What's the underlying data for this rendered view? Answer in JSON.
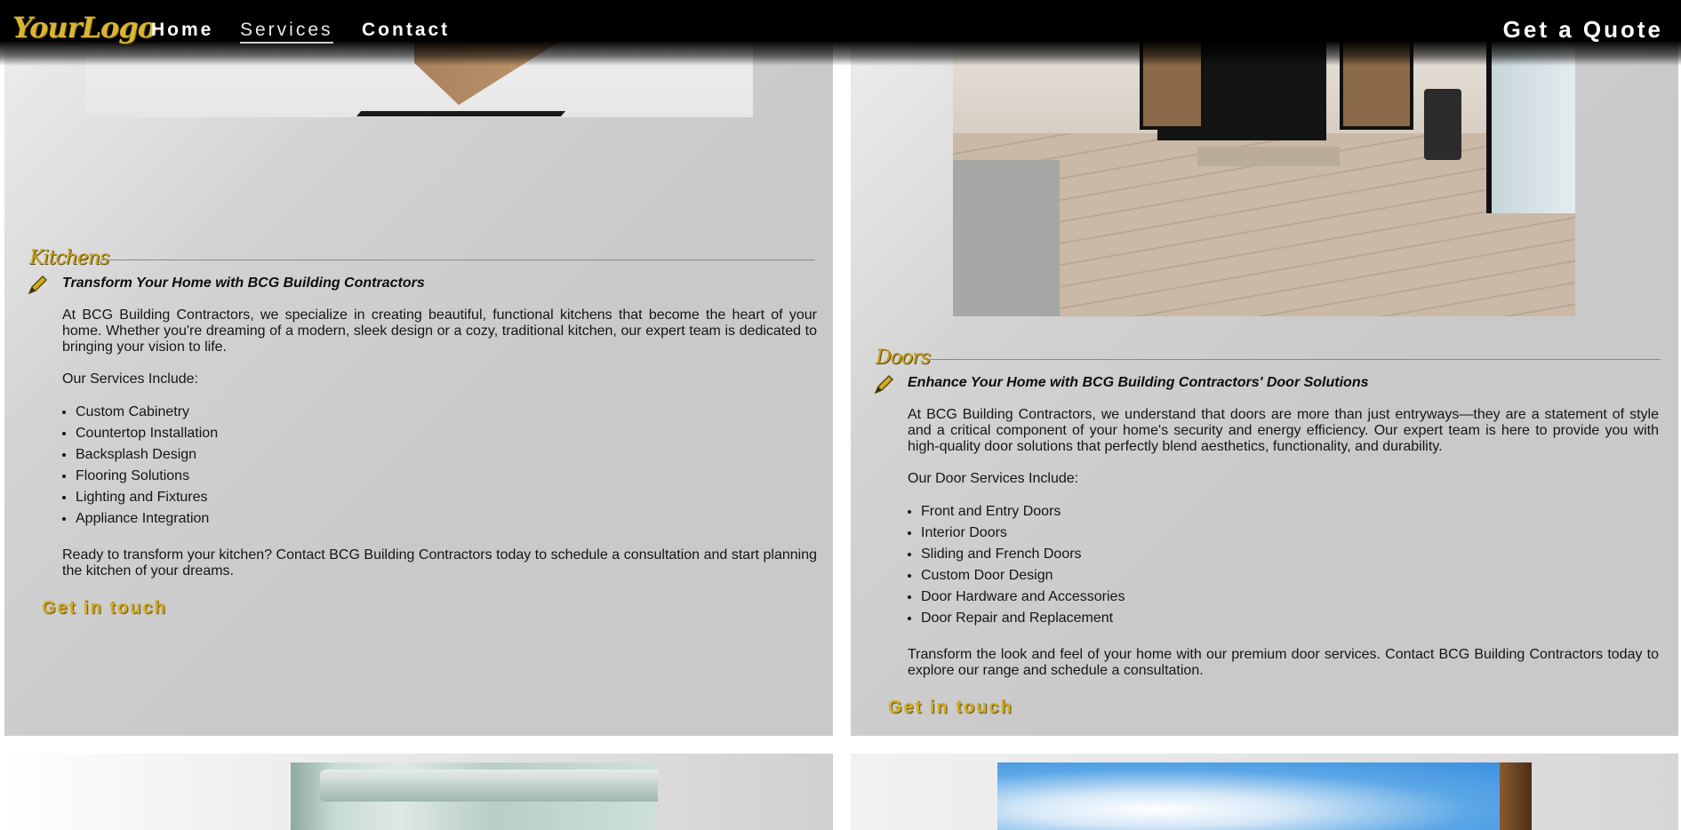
{
  "nav": {
    "logo": "YourLogo",
    "links": [
      "Home",
      "Services",
      "Contact"
    ],
    "active": "Services",
    "quote": "Get a Quote"
  },
  "kitchens": {
    "title": "Kitchens",
    "subhead": "Transform Your Home with BCG Building Contractors",
    "intro": "At BCG Building Contractors, we specialize in creating beautiful, functional kitchens that become the heart of your home. Whether you're dreaming of a modern, sleek design or a cozy, traditional kitchen, our expert team is dedicated to bringing your vision to life.",
    "services_label": "Our Services Include:",
    "services": [
      "Custom Cabinetry",
      "Countertop Installation",
      "Backsplash Design",
      "Flooring Solutions",
      "Lighting and Fixtures",
      "Appliance Integration"
    ],
    "closing": "Ready to transform your kitchen? Contact BCG Building Contractors today to schedule a consultation and start planning the kitchen of your dreams.",
    "cta": "Get in touch"
  },
  "doors": {
    "title": "Doors",
    "subhead": "Enhance Your Home with BCG Building Contractors' Door Solutions",
    "intro": "At BCG Building Contractors, we understand that doors are more than just entryways—they are a statement of style and a critical component of your home's security and energy efficiency. Our expert team is here to provide you with high-quality door solutions that perfectly blend aesthetics, functionality, and durability.",
    "services_label": "Our Door Services Include:",
    "services": [
      "Front and Entry Doors",
      "Interior Doors",
      "Sliding and French Doors",
      "Custom Door Design",
      "Door Hardware and Accessories",
      "Door Repair and Replacement"
    ],
    "closing": "Transform the look and feel of your home with our premium door services. Contact BCG Building Contractors today to explore our range and schedule a consultation.",
    "cta": "Get in touch"
  },
  "colors": {
    "gold": "#d4ad1e",
    "nav_bg": "#000000",
    "panel_bg": "#c9c9c9"
  }
}
